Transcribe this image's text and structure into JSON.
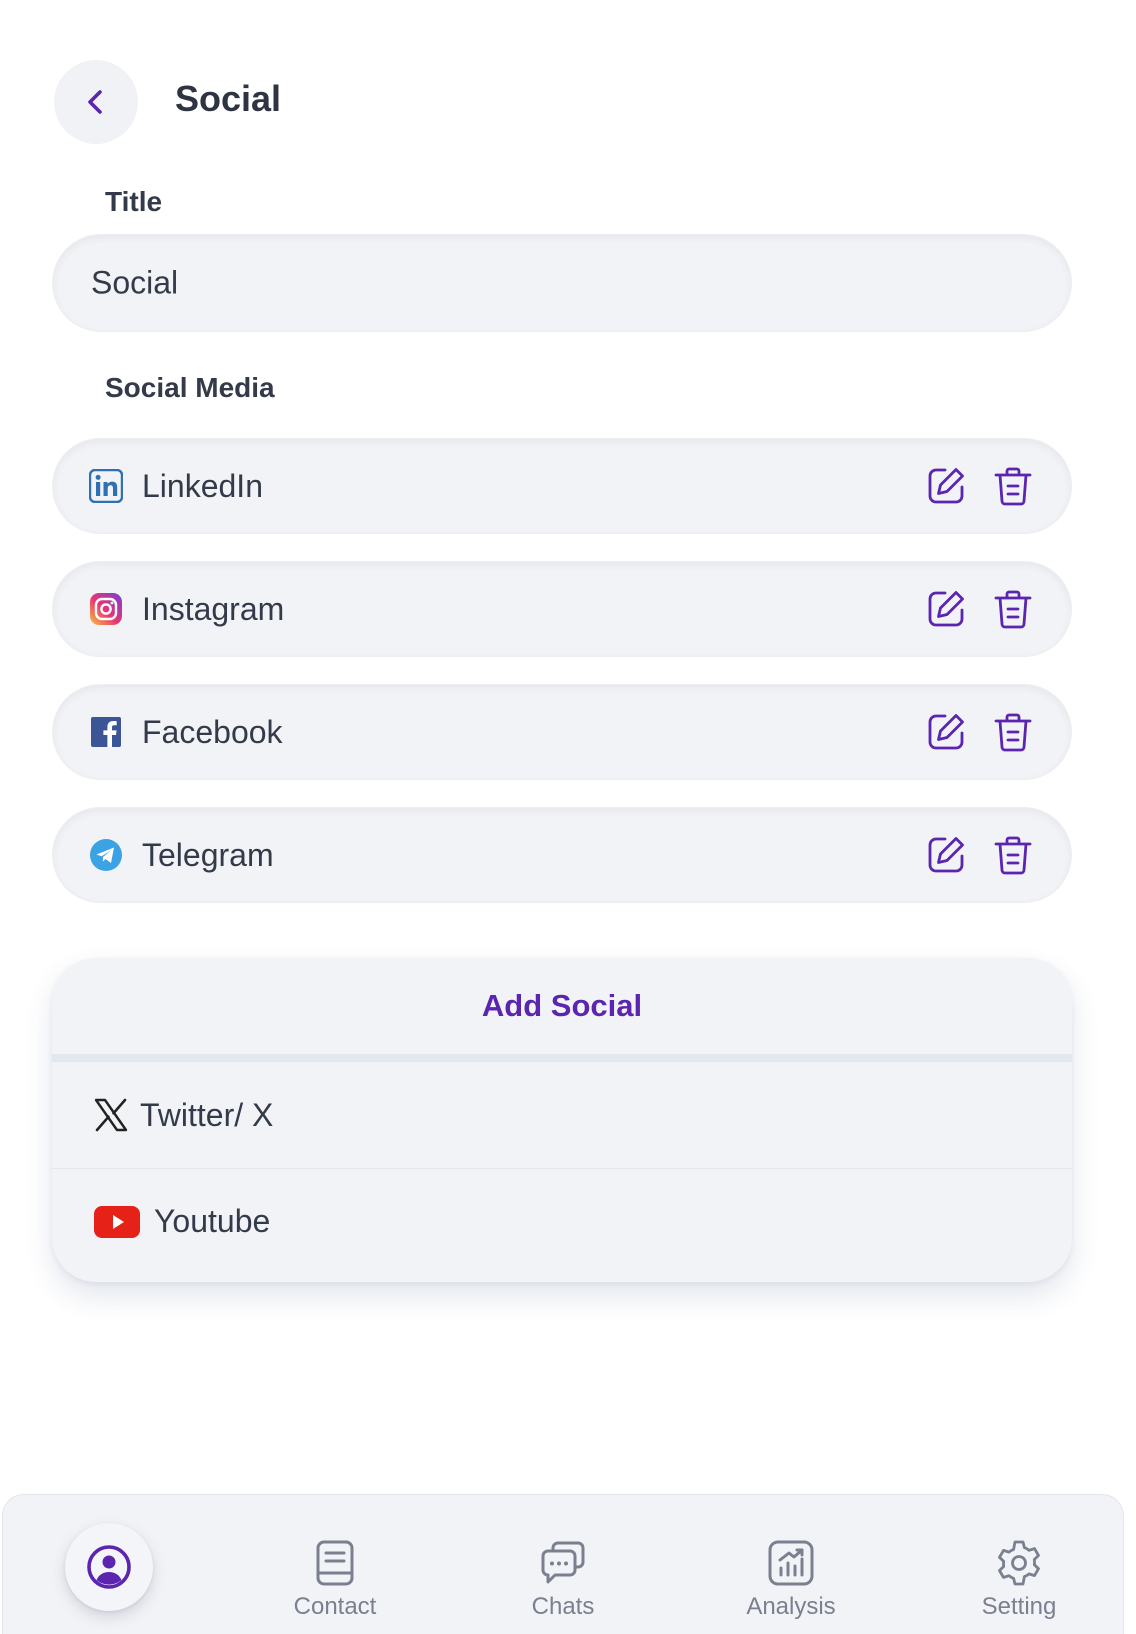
{
  "header": {
    "title": "Social",
    "back_icon": "chevron-left-icon"
  },
  "title_section": {
    "label": "Title",
    "value": "Social"
  },
  "social_section": {
    "label": "Social Media",
    "items": [
      {
        "name": "LinkedIn",
        "icon": "linkedin-icon",
        "color": "#2f6fb3"
      },
      {
        "name": "Instagram",
        "icon": "instagram-icon",
        "color": "#d6327f"
      },
      {
        "name": "Facebook",
        "icon": "facebook-icon",
        "color": "#3b5595"
      },
      {
        "name": "Telegram",
        "icon": "telegram-icon",
        "color": "#3ba2e4"
      }
    ],
    "edit_icon": "edit-icon",
    "delete_icon": "trash-icon"
  },
  "add_social": {
    "title": "Add Social",
    "options": [
      {
        "name": "Twitter/ X",
        "icon": "x-twitter-icon"
      },
      {
        "name": "Youtube",
        "icon": "youtube-icon",
        "color": "#e62117"
      }
    ]
  },
  "bottom_nav": {
    "items": [
      {
        "label": "",
        "icon": "profile-icon",
        "active": true
      },
      {
        "label": "Contact",
        "icon": "contact-icon"
      },
      {
        "label": "Chats",
        "icon": "chats-icon"
      },
      {
        "label": "Analysis",
        "icon": "analysis-icon"
      },
      {
        "label": "Setting",
        "icon": "gear-icon"
      }
    ]
  },
  "colors": {
    "accent": "#5b25b0",
    "field_bg": "#f2f3f6",
    "text": "#333a49",
    "muted": "#7a8090"
  }
}
